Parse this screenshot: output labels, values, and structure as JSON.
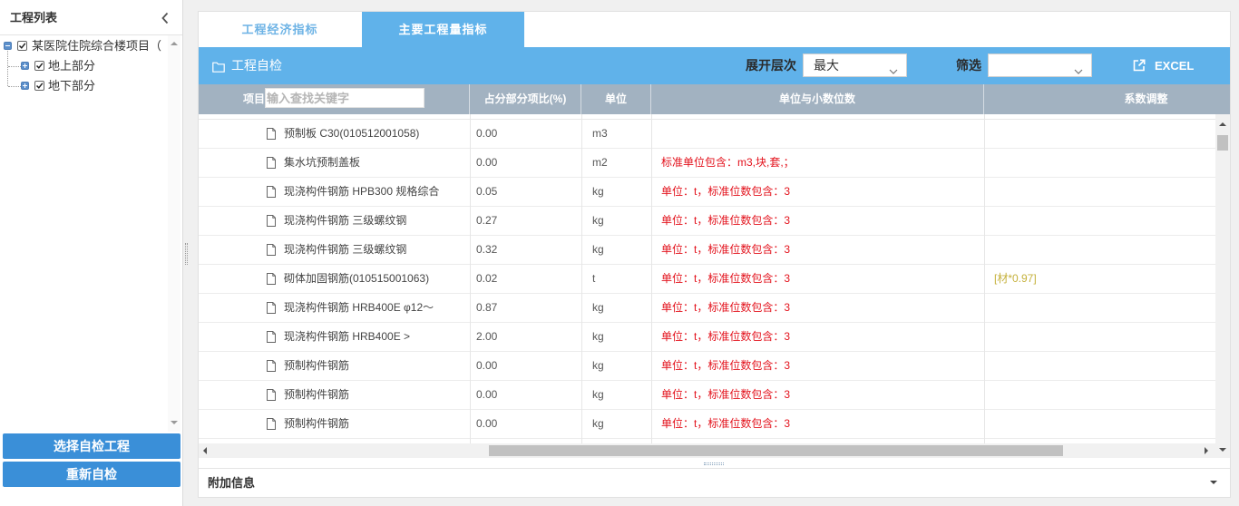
{
  "left_panel": {
    "title": "工程列表",
    "tree": {
      "root": {
        "label": "某医院住院综合楼项目（",
        "checked": true,
        "expanded": true
      },
      "children": [
        {
          "label": "地上部分",
          "checked": true,
          "expanded": false
        },
        {
          "label": "地下部分",
          "checked": true,
          "expanded": false
        }
      ]
    },
    "buttons": {
      "select_project": "选择自检工程",
      "recheck": "重新自检"
    }
  },
  "tabs": [
    {
      "label": "工程经济指标",
      "active": false
    },
    {
      "label": "主要工程量指标",
      "active": true
    }
  ],
  "toolbar": {
    "title": "工程自检",
    "level_label": "展开层次",
    "level_value": "最大",
    "filter_label": "筛选",
    "export_label": "EXCEL"
  },
  "table": {
    "columns": [
      "项目",
      "占分部分项比(%)",
      "单位",
      "单位与小数位数",
      "系数调整"
    ],
    "search_placeholder": "输入查找关键字",
    "rows": [
      {
        "name": "预制板 C30(010512001058)",
        "ratio": "0.00",
        "unit": "m3"
      },
      {
        "name": "集水坑预制盖板",
        "ratio": "0.00",
        "unit": "m2",
        "unit_check": "标准单位包含：m3,块,套,；"
      },
      {
        "name": "现浇构件钢筋 HPB300 规格综合",
        "ratio": "0.05",
        "unit": "kg",
        "unit_check": "单位：t，标准位数包含：3"
      },
      {
        "name": "现浇构件钢筋 三级螺纹钢",
        "ratio": "0.27",
        "unit": "kg",
        "unit_check": "单位：t，标准位数包含：3"
      },
      {
        "name": "现浇构件钢筋 三级螺纹钢",
        "ratio": "0.32",
        "unit": "kg",
        "unit_check": "单位：t，标准位数包含：3"
      },
      {
        "name": "砌体加固钢筋(010515001063)",
        "ratio": "0.02",
        "unit": "t",
        "unit_check": "单位：t，标准位数包含：3",
        "coef": "[材*0.97]"
      },
      {
        "name": "现浇构件钢筋 HRB400E φ12～",
        "ratio": "0.87",
        "unit": "kg",
        "unit_check": "单位：t，标准位数包含：3"
      },
      {
        "name": "现浇构件钢筋 HRB400E >",
        "ratio": "2.00",
        "unit": "kg",
        "unit_check": "单位：t，标准位数包含：3"
      },
      {
        "name": "预制构件钢筋",
        "ratio": "0.00",
        "unit": "kg",
        "unit_check": "单位：t，标准位数包含：3"
      },
      {
        "name": "预制构件钢筋",
        "ratio": "0.00",
        "unit": "kg",
        "unit_check": "单位：t，标准位数包含：3"
      },
      {
        "name": "预制构件钢筋",
        "ratio": "0.00",
        "unit": "kg",
        "unit_check": "单位：t，标准位数包含：3"
      }
    ]
  },
  "footer": {
    "title": "附加信息"
  },
  "icons": {
    "panel_collapse": "chevron-left-icon",
    "toolbar": "folder-icon",
    "export": "external-link-icon",
    "row": "document-icon",
    "select": "chevron-down-icon"
  },
  "colors": {
    "accent": "#60b2ea",
    "button": "#3a8fd8",
    "header_bg": "#a2b2c1",
    "error_text": "#e3121c",
    "coefficient_text": "#c5b13c",
    "inactive_tab_text": "#6db3e5"
  }
}
